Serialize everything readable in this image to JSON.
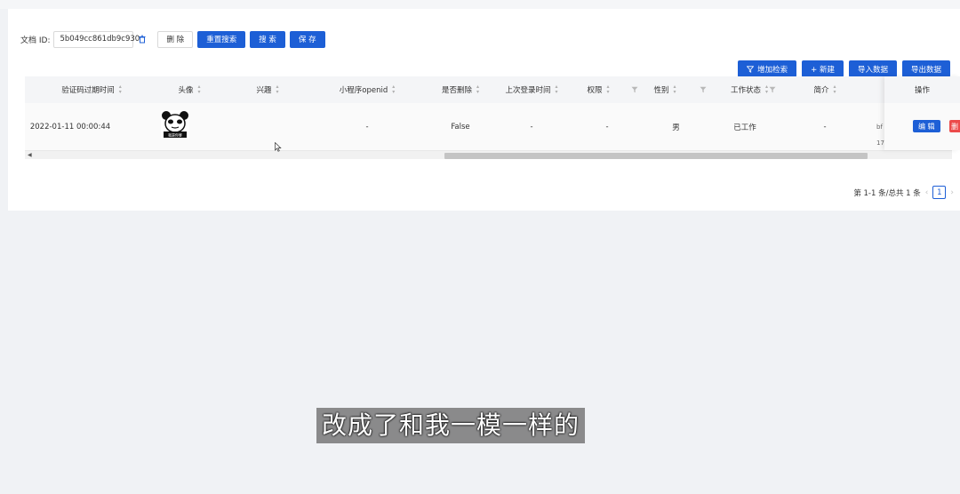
{
  "search": {
    "label": "文档 ID:",
    "doc_id_value": "5b049cc861db9c930",
    "delete_label": "删 除",
    "reset_label": "重置搜索",
    "search_label": "搜 索",
    "save_label": "保 存"
  },
  "actions": {
    "add_search_label": "增加检索",
    "new_label": "+ 新建",
    "import_label": "导入数据",
    "export_label": "导出数据"
  },
  "table": {
    "columns": [
      "验证码过期时间",
      "头像",
      "兴趣",
      "小程序openid",
      "是否删除",
      "上次登录时间",
      "权限",
      "性别",
      "工作状态",
      "简介",
      "操作"
    ],
    "rows": [
      {
        "expire_time": "2022-01-11 00:00:44",
        "interest": "",
        "openid": "-",
        "deleted": "False",
        "last_login": "-",
        "permission": "-",
        "gender": "男",
        "work_status": "已工作",
        "intro": "-",
        "clip_top": "bf",
        "clip_bottom": "17",
        "edit_label": "编 辑",
        "delete_label": "删"
      }
    ]
  },
  "pagination": {
    "summary": "第 1-1 条/总共 1 条",
    "current_page": "1",
    "prev": "‹",
    "next": "›"
  },
  "subtitle": "改成了和我一模一样的",
  "colors": {
    "primary": "#1d5fd6",
    "danger": "#ec4b4b",
    "header_bg": "#f4f5f7"
  }
}
